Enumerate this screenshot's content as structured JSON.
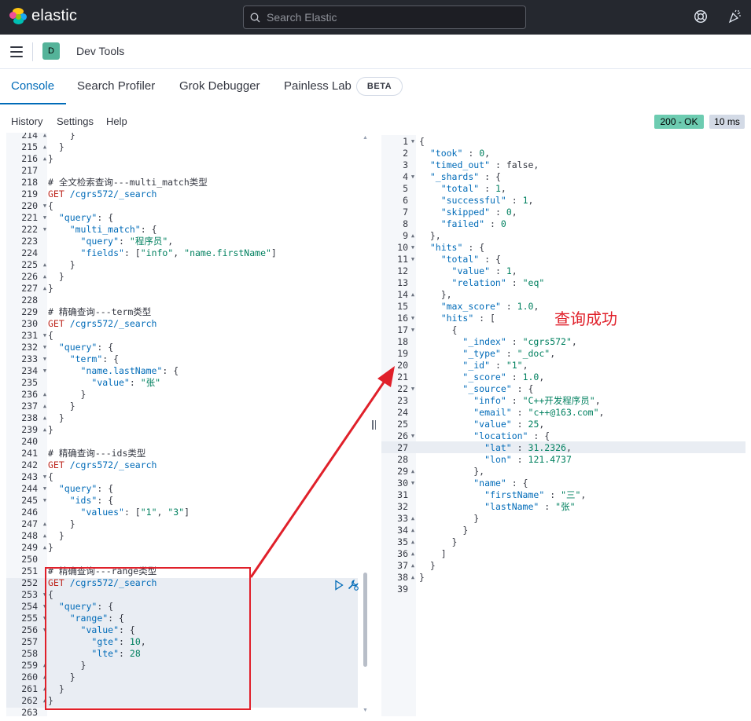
{
  "header": {
    "brand": "elastic",
    "search_placeholder": "Search Elastic"
  },
  "breadcrumb": {
    "avatar_letter": "D",
    "title": "Dev Tools"
  },
  "tabs": [
    {
      "label": "Console"
    },
    {
      "label": "Search Profiler"
    },
    {
      "label": "Grok Debugger"
    },
    {
      "label": "Painless Lab"
    }
  ],
  "beta_badge": "BETA",
  "console_menu": [
    "History",
    "Settings",
    "Help"
  ],
  "response_status": "200 - OK",
  "response_time": "10 ms",
  "annotation_text": "查询成功",
  "request_lines": [
    {
      "n": "214",
      "fold": "^",
      "t": "    }"
    },
    {
      "n": "215",
      "fold": "^",
      "t": "  }"
    },
    {
      "n": "216",
      "fold": "^",
      "t": "}"
    },
    {
      "n": "217",
      "fold": "",
      "t": ""
    },
    {
      "n": "218",
      "fold": "",
      "t": "# 全文检索查询---multi_match类型"
    },
    {
      "n": "219",
      "fold": "",
      "t": "GET /cgrs572/_search"
    },
    {
      "n": "220",
      "fold": "v",
      "t": "{"
    },
    {
      "n": "221",
      "fold": "v",
      "t": "  \"query\": {"
    },
    {
      "n": "222",
      "fold": "v",
      "t": "    \"multi_match\": {"
    },
    {
      "n": "223",
      "fold": "",
      "t": "      \"query\": \"程序员\","
    },
    {
      "n": "224",
      "fold": "",
      "t": "      \"fields\": [\"info\", \"name.firstName\"]"
    },
    {
      "n": "225",
      "fold": "^",
      "t": "    }"
    },
    {
      "n": "226",
      "fold": "^",
      "t": "  }"
    },
    {
      "n": "227",
      "fold": "^",
      "t": "}"
    },
    {
      "n": "228",
      "fold": "",
      "t": ""
    },
    {
      "n": "229",
      "fold": "",
      "t": "# 精确查询---term类型"
    },
    {
      "n": "230",
      "fold": "",
      "t": "GET /cgrs572/_search"
    },
    {
      "n": "231",
      "fold": "v",
      "t": "{"
    },
    {
      "n": "232",
      "fold": "v",
      "t": "  \"query\": {"
    },
    {
      "n": "233",
      "fold": "v",
      "t": "    \"term\": {"
    },
    {
      "n": "234",
      "fold": "v",
      "t": "      \"name.lastName\": {"
    },
    {
      "n": "235",
      "fold": "",
      "t": "        \"value\": \"张\""
    },
    {
      "n": "236",
      "fold": "^",
      "t": "      }"
    },
    {
      "n": "237",
      "fold": "^",
      "t": "    }"
    },
    {
      "n": "238",
      "fold": "^",
      "t": "  }"
    },
    {
      "n": "239",
      "fold": "^",
      "t": "}"
    },
    {
      "n": "240",
      "fold": "",
      "t": ""
    },
    {
      "n": "241",
      "fold": "",
      "t": "# 精确查询---ids类型"
    },
    {
      "n": "242",
      "fold": "",
      "t": "GET /cgrs572/_search"
    },
    {
      "n": "243",
      "fold": "v",
      "t": "{"
    },
    {
      "n": "244",
      "fold": "v",
      "t": "  \"query\": {"
    },
    {
      "n": "245",
      "fold": "v",
      "t": "    \"ids\": {"
    },
    {
      "n": "246",
      "fold": "",
      "t": "      \"values\": [\"1\", \"3\"]"
    },
    {
      "n": "247",
      "fold": "^",
      "t": "    }"
    },
    {
      "n": "248",
      "fold": "^",
      "t": "  }"
    },
    {
      "n": "249",
      "fold": "^",
      "t": "}"
    },
    {
      "n": "250",
      "fold": "",
      "t": ""
    },
    {
      "n": "251",
      "fold": "",
      "t": "# 精确查询---range类型"
    },
    {
      "n": "252",
      "fold": "",
      "t": "GET /cgrs572/_search"
    },
    {
      "n": "253",
      "fold": "v",
      "t": "{"
    },
    {
      "n": "254",
      "fold": "v",
      "t": "  \"query\": {"
    },
    {
      "n": "255",
      "fold": "v",
      "t": "    \"range\": {"
    },
    {
      "n": "256",
      "fold": "v",
      "t": "      \"value\": {"
    },
    {
      "n": "257",
      "fold": "",
      "t": "        \"gte\": 10,"
    },
    {
      "n": "258",
      "fold": "",
      "t": "        \"lte\": 28"
    },
    {
      "n": "259",
      "fold": "^",
      "t": "      }"
    },
    {
      "n": "260",
      "fold": "^",
      "t": "    }"
    },
    {
      "n": "261",
      "fold": "^",
      "t": "  }"
    },
    {
      "n": "262",
      "fold": "^",
      "t": "}"
    },
    {
      "n": "263",
      "fold": "",
      "t": ""
    }
  ],
  "response_lines": [
    {
      "n": "1",
      "fold": "v",
      "t": "{"
    },
    {
      "n": "2",
      "fold": "",
      "t": "  \"took\" : 0,"
    },
    {
      "n": "3",
      "fold": "",
      "t": "  \"timed_out\" : false,"
    },
    {
      "n": "4",
      "fold": "v",
      "t": "  \"_shards\" : {"
    },
    {
      "n": "5",
      "fold": "",
      "t": "    \"total\" : 1,"
    },
    {
      "n": "6",
      "fold": "",
      "t": "    \"successful\" : 1,"
    },
    {
      "n": "7",
      "fold": "",
      "t": "    \"skipped\" : 0,"
    },
    {
      "n": "8",
      "fold": "",
      "t": "    \"failed\" : 0"
    },
    {
      "n": "9",
      "fold": "^",
      "t": "  },"
    },
    {
      "n": "10",
      "fold": "v",
      "t": "  \"hits\" : {"
    },
    {
      "n": "11",
      "fold": "v",
      "t": "    \"total\" : {"
    },
    {
      "n": "12",
      "fold": "",
      "t": "      \"value\" : 1,"
    },
    {
      "n": "13",
      "fold": "",
      "t": "      \"relation\" : \"eq\""
    },
    {
      "n": "14",
      "fold": "^",
      "t": "    },"
    },
    {
      "n": "15",
      "fold": "",
      "t": "    \"max_score\" : 1.0,"
    },
    {
      "n": "16",
      "fold": "v",
      "t": "    \"hits\" : ["
    },
    {
      "n": "17",
      "fold": "v",
      "t": "      {"
    },
    {
      "n": "18",
      "fold": "",
      "t": "        \"_index\" : \"cgrs572\","
    },
    {
      "n": "19",
      "fold": "",
      "t": "        \"_type\" : \"_doc\","
    },
    {
      "n": "20",
      "fold": "",
      "t": "        \"_id\" : \"1\","
    },
    {
      "n": "21",
      "fold": "",
      "t": "        \"_score\" : 1.0,"
    },
    {
      "n": "22",
      "fold": "v",
      "t": "        \"_source\" : {"
    },
    {
      "n": "23",
      "fold": "",
      "t": "          \"info\" : \"C++开发程序员\","
    },
    {
      "n": "24",
      "fold": "",
      "t": "          \"email\" : \"c++@163.com\","
    },
    {
      "n": "25",
      "fold": "",
      "t": "          \"value\" : 25,"
    },
    {
      "n": "26",
      "fold": "v",
      "t": "          \"location\" : {"
    },
    {
      "n": "27",
      "fold": "",
      "t": "            \"lat\" : 31.2326,"
    },
    {
      "n": "28",
      "fold": "",
      "t": "            \"lon\" : 121.4737"
    },
    {
      "n": "29",
      "fold": "^",
      "t": "          },"
    },
    {
      "n": "30",
      "fold": "v",
      "t": "          \"name\" : {"
    },
    {
      "n": "31",
      "fold": "",
      "t": "            \"firstName\" : \"三\","
    },
    {
      "n": "32",
      "fold": "",
      "t": "            \"lastName\" : \"张\""
    },
    {
      "n": "33",
      "fold": "^",
      "t": "          }"
    },
    {
      "n": "34",
      "fold": "^",
      "t": "        }"
    },
    {
      "n": "35",
      "fold": "^",
      "t": "      }"
    },
    {
      "n": "36",
      "fold": "^",
      "t": "    ]"
    },
    {
      "n": "37",
      "fold": "^",
      "t": "  }"
    },
    {
      "n": "38",
      "fold": "^",
      "t": "}"
    },
    {
      "n": "39",
      "fold": "",
      "t": ""
    }
  ],
  "colors": {
    "header_bg": "#25282f",
    "accent": "#006bb8",
    "status_ok": "#6dccb1",
    "annotation": "#e0202a"
  }
}
